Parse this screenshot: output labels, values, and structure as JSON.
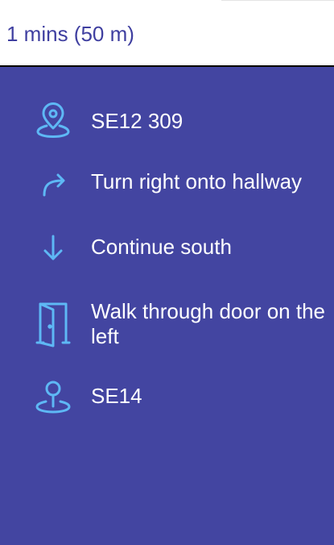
{
  "summary": {
    "duration_text": "1 mins (50 m)"
  },
  "colors": {
    "panel_bg": "#4345a1",
    "icon": "#5eb8f5",
    "summary_text": "#3f3fa0",
    "step_text": "#ffffff"
  },
  "steps": [
    {
      "icon": "location-pin-icon",
      "text": "SE12 309"
    },
    {
      "icon": "turn-right-arrow-icon",
      "text": "Turn right onto hallway"
    },
    {
      "icon": "arrow-down-icon",
      "text": "Continue south"
    },
    {
      "icon": "door-icon",
      "text": "Walk through door on the left"
    },
    {
      "icon": "destination-pin-icon",
      "text": "SE14"
    }
  ]
}
